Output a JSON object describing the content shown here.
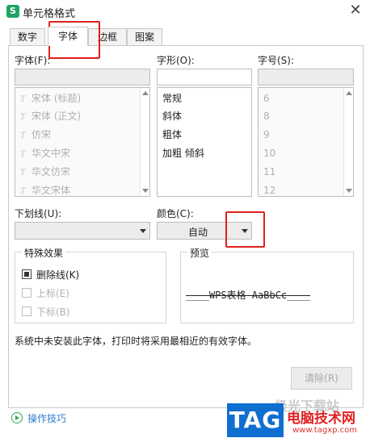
{
  "window": {
    "title": "单元格格式",
    "app_icon_letter": "S",
    "close_glyph": "✕"
  },
  "tabs": [
    {
      "label": "数字"
    },
    {
      "label": "字体"
    },
    {
      "label": "边框"
    },
    {
      "label": "图案"
    }
  ],
  "font": {
    "label": "字体(F):",
    "value": "",
    "items": [
      {
        "label": "宋体 (标题)"
      },
      {
        "label": "宋体 (正文)"
      },
      {
        "label": "仿宋"
      },
      {
        "label": "华文中宋"
      },
      {
        "label": "华文仿宋"
      },
      {
        "label": "华文宋体"
      }
    ]
  },
  "style": {
    "label": "字形(O):",
    "value": "",
    "items": [
      {
        "label": "常规"
      },
      {
        "label": "斜体"
      },
      {
        "label": "粗体"
      },
      {
        "label": "加粗 倾斜"
      }
    ]
  },
  "size": {
    "label": "字号(S):",
    "value": "",
    "items": [
      {
        "label": "6"
      },
      {
        "label": "8"
      },
      {
        "label": "9"
      },
      {
        "label": "10"
      },
      {
        "label": "11"
      },
      {
        "label": "12"
      }
    ]
  },
  "underline": {
    "label": "下划线(U):",
    "value": ""
  },
  "color": {
    "label": "颜色(C):",
    "value": "自动"
  },
  "effects": {
    "title": "特殊效果",
    "strikethrough": {
      "label": "删除线(K)",
      "checked": true
    },
    "superscript": {
      "label": "上标(E)",
      "checked": false
    },
    "subscript": {
      "label": "下标(B)",
      "checked": false
    }
  },
  "preview": {
    "title": "预览",
    "text": "____WPS表格  AaBbCc____"
  },
  "hint": "系统中未安装此字体，打印时将采用最相近的有效字体。",
  "buttons": {
    "clear": "清除(R)"
  },
  "footer": {
    "tips": "操作技巧"
  },
  "watermark": {
    "badge": "TAG",
    "site_cn": "电脑技术网",
    "url": "www.tagxp.com",
    "faint": "极光下载站"
  },
  "colors": {
    "highlight": "#e0201c",
    "link": "#2f7dd4",
    "brand_green": "#1fa463",
    "tag_blue": "#0f6fd1"
  }
}
